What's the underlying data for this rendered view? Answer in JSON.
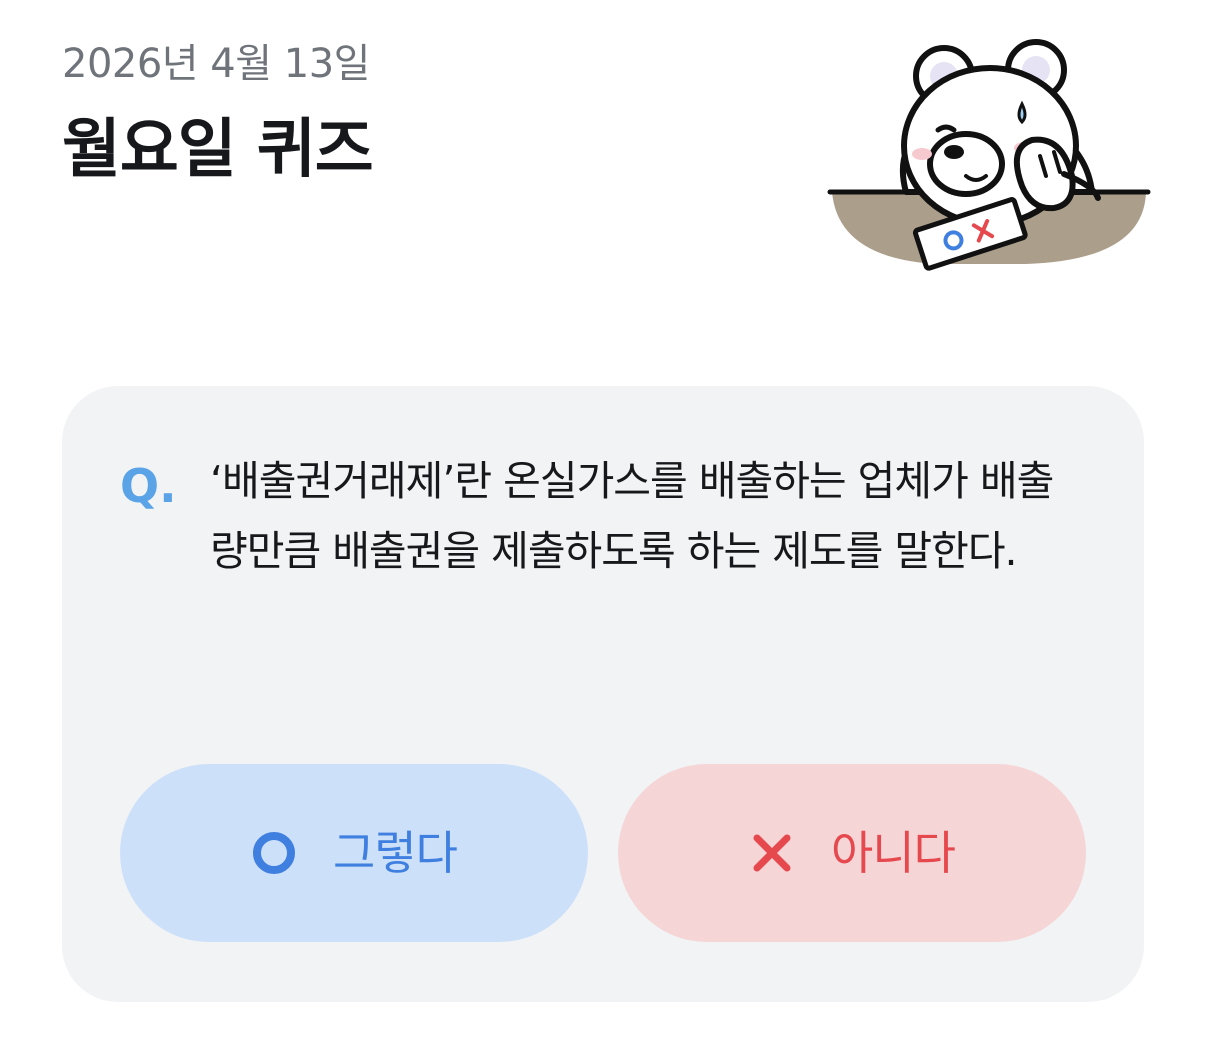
{
  "header": {
    "date": "2026년 4월 13일",
    "title": "월요일 퀴즈"
  },
  "illustration": {
    "name": "bear-with-ox-card",
    "card_text": "OX"
  },
  "quiz": {
    "q_label": "Q.",
    "question": "‘배출권거래제’란 온실가스를 배출하는 업체가 배출량만큼 배출권을 제출하도록 하는 제도를 말한다.",
    "yes": {
      "icon": "circle-o-icon",
      "label": "그렇다",
      "color": "#3f7fe0",
      "bg": "#cde0f9"
    },
    "no": {
      "icon": "x-icon",
      "label": "아니다",
      "color": "#e5484d",
      "bg": "#f6d5d7"
    }
  },
  "colors": {
    "card_bg": "#f2f3f5",
    "q_accent": "#5aa3e6",
    "date_text": "#6f747a",
    "title_text": "#16181b"
  }
}
